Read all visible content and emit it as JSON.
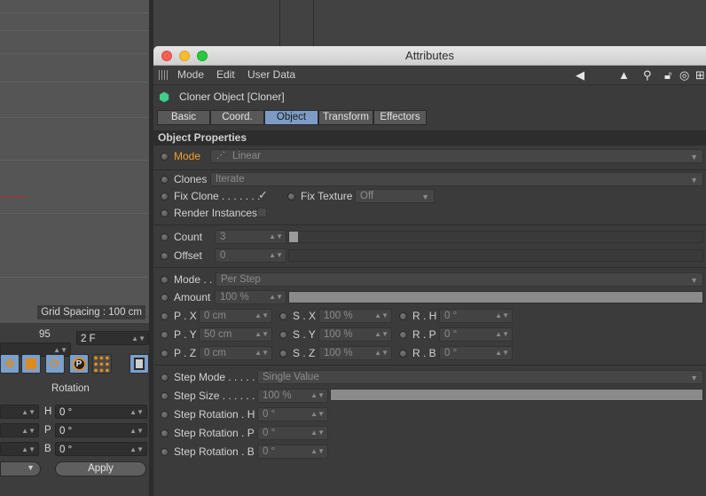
{
  "viewport": {
    "grid_spacing": "Grid Spacing : 100 cm"
  },
  "left_panel": {
    "frame_value": "95",
    "frame_field": "2 F",
    "rotation_header": "Rotation",
    "rotation_rows": [
      {
        "axis": "H",
        "value": "0 °"
      },
      {
        "axis": "P",
        "value": "0 °"
      },
      {
        "axis": "B",
        "value": "0 °"
      }
    ],
    "apply_label": "Apply"
  },
  "window": {
    "title": "Attributes",
    "menu": [
      "Mode",
      "Edit",
      "User Data"
    ],
    "object_title": "Cloner Object [Cloner]",
    "tabs": [
      {
        "label": "Basic",
        "active": false
      },
      {
        "label": "Coord.",
        "active": false
      },
      {
        "label": "Object",
        "active": true
      },
      {
        "label": "Transform",
        "active": false
      },
      {
        "label": "Effectors",
        "active": false
      }
    ],
    "section_title": "Object Properties"
  },
  "props": {
    "mode": {
      "label": "Mode",
      "value": "Linear"
    },
    "clones": {
      "label": "Clones",
      "value": "Iterate"
    },
    "fix_clone": {
      "label": "Fix Clone . . . . . . .",
      "checked": true
    },
    "fix_texture": {
      "label": "Fix Texture",
      "value": "Off"
    },
    "render_instances": {
      "label": "Render Instances",
      "checked": false
    },
    "count": {
      "label": "Count",
      "value": "3",
      "slider_fraction": 0.02
    },
    "offset": {
      "label": "Offset",
      "value": "0",
      "slider_fraction": 0
    },
    "mode2": {
      "label": "Mode . .",
      "value": "Per Step"
    },
    "amount": {
      "label": "Amount",
      "value": "100 %",
      "slider_fraction": 1.0
    },
    "pos": [
      {
        "label": "P . X",
        "value": "0 cm"
      },
      {
        "label": "P . Y",
        "value": "50 cm"
      },
      {
        "label": "P . Z",
        "value": "0 cm"
      }
    ],
    "scale": [
      {
        "label": "S . X",
        "value": "100 %"
      },
      {
        "label": "S . Y",
        "value": "100 %"
      },
      {
        "label": "S . Z",
        "value": "100 %"
      }
    ],
    "rot": [
      {
        "label": "R . H",
        "value": "0 °"
      },
      {
        "label": "R . P",
        "value": "0 °"
      },
      {
        "label": "R . B",
        "value": "0 °"
      }
    ],
    "step_mode": {
      "label": "Step Mode . . . . . .",
      "value": "Single Value"
    },
    "step_size": {
      "label": "Step Size . . . . . . .",
      "value": "100 %",
      "slider_fraction": 1.0
    },
    "step_rot": [
      {
        "label": "Step Rotation . H",
        "value": "0 °"
      },
      {
        "label": "Step Rotation . P",
        "value": "0 °"
      },
      {
        "label": "Step Rotation . B",
        "value": "0 °"
      }
    ]
  },
  "colors": {
    "accent": "#7c9cc6",
    "active_label": "#f0a030"
  }
}
